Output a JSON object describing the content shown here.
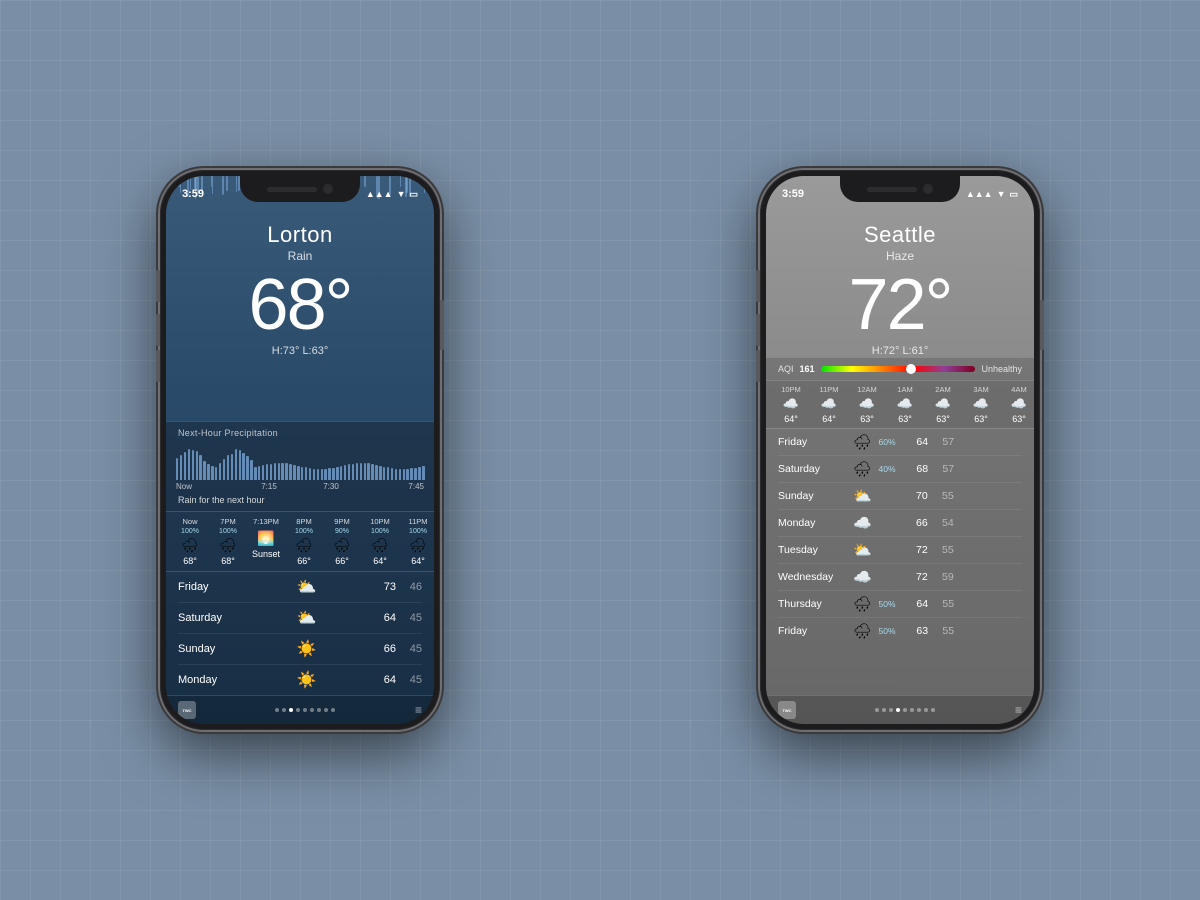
{
  "background": {
    "color": "#7a8fa6"
  },
  "lorton": {
    "status_time": "3:59",
    "city": "Lorton",
    "condition": "Rain",
    "temperature": "68°",
    "hi_lo": "H:73°  L:63°",
    "precip_label": "Next-Hour Precipitation",
    "precip_times": [
      "Now",
      "7:15",
      "7:30",
      "7:45"
    ],
    "rain_message": "Rain for the next hour",
    "hourly": [
      {
        "time": "Now",
        "pct": "100%",
        "icon": "🌧",
        "temp": "68°"
      },
      {
        "time": "7PM",
        "pct": "100%",
        "icon": "🌧",
        "temp": "68°"
      },
      {
        "time": "7:13PM",
        "pct": "",
        "icon": "🌅",
        "temp": "Sunset"
      },
      {
        "time": "8PM",
        "pct": "100%",
        "icon": "🌧",
        "temp": "66°"
      },
      {
        "time": "9PM",
        "pct": "90%",
        "icon": "🌧",
        "temp": "66°"
      },
      {
        "time": "10PM",
        "pct": "100%",
        "icon": "🌧",
        "temp": "64°"
      },
      {
        "time": "11PM",
        "pct": "100%",
        "icon": "🌧",
        "temp": "64°"
      }
    ],
    "daily": [
      {
        "day": "Friday",
        "icon": "⛅",
        "hi": "73",
        "lo": "46"
      },
      {
        "day": "Saturday",
        "icon": "⛅",
        "hi": "64",
        "lo": "45"
      },
      {
        "day": "Sunday",
        "icon": "☀️",
        "hi": "66",
        "lo": "45"
      },
      {
        "day": "Monday",
        "icon": "☀️",
        "hi": "64",
        "lo": "45"
      }
    ],
    "dots": [
      0,
      1,
      2,
      3,
      4,
      5,
      6,
      7,
      8
    ],
    "active_dot": 2
  },
  "seattle": {
    "status_time": "3:59",
    "city": "Seattle",
    "condition": "Haze",
    "temperature": "72°",
    "hi_lo": "H:72°  L:61°",
    "aqi_label": "AQI",
    "aqi_value": "161",
    "aqi_status": "Unhealthy",
    "hourly": [
      {
        "time": "10PM",
        "icon": "☁️",
        "temp": "64°"
      },
      {
        "time": "11PM",
        "icon": "☁️",
        "temp": "64°"
      },
      {
        "time": "12AM",
        "icon": "☁️",
        "temp": "63°"
      },
      {
        "time": "1AM",
        "icon": "☁️",
        "temp": "63°"
      },
      {
        "time": "2AM",
        "icon": "☁️",
        "temp": "63°"
      },
      {
        "time": "3AM",
        "icon": "☁️",
        "temp": "63°"
      },
      {
        "time": "4AM",
        "icon": "☁️",
        "temp": "63°"
      }
    ],
    "daily": [
      {
        "day": "Friday",
        "icon": "🌧",
        "pct": "60%",
        "hi": "64",
        "lo": "57"
      },
      {
        "day": "Saturday",
        "icon": "🌧",
        "pct": "40%",
        "hi": "68",
        "lo": "57"
      },
      {
        "day": "Sunday",
        "icon": "⛅",
        "pct": "",
        "hi": "70",
        "lo": "55"
      },
      {
        "day": "Monday",
        "icon": "☁️",
        "pct": "",
        "hi": "66",
        "lo": "54"
      },
      {
        "day": "Tuesday",
        "icon": "⛅",
        "pct": "",
        "hi": "72",
        "lo": "55"
      },
      {
        "day": "Wednesday",
        "icon": "☁️",
        "pct": "",
        "hi": "72",
        "lo": "59"
      },
      {
        "day": "Thursday",
        "icon": "🌧",
        "pct": "50%",
        "hi": "64",
        "lo": "55"
      },
      {
        "day": "Friday",
        "icon": "🌧",
        "pct": "50%",
        "hi": "63",
        "lo": "55"
      }
    ]
  },
  "precip_bars": [
    8,
    9,
    10,
    10,
    9,
    9,
    10,
    10,
    10,
    9,
    8,
    7,
    6,
    6,
    6,
    7,
    7,
    7,
    7,
    7,
    7,
    7,
    7,
    7,
    7,
    7,
    7,
    7,
    7,
    7,
    7,
    7,
    7,
    7,
    7,
    7,
    7,
    7,
    7,
    7,
    7,
    7,
    7,
    7,
    7,
    7,
    7,
    7,
    7,
    7,
    7,
    7,
    7,
    7,
    7,
    7,
    7,
    7,
    7,
    7,
    7,
    7,
    7,
    7
  ]
}
